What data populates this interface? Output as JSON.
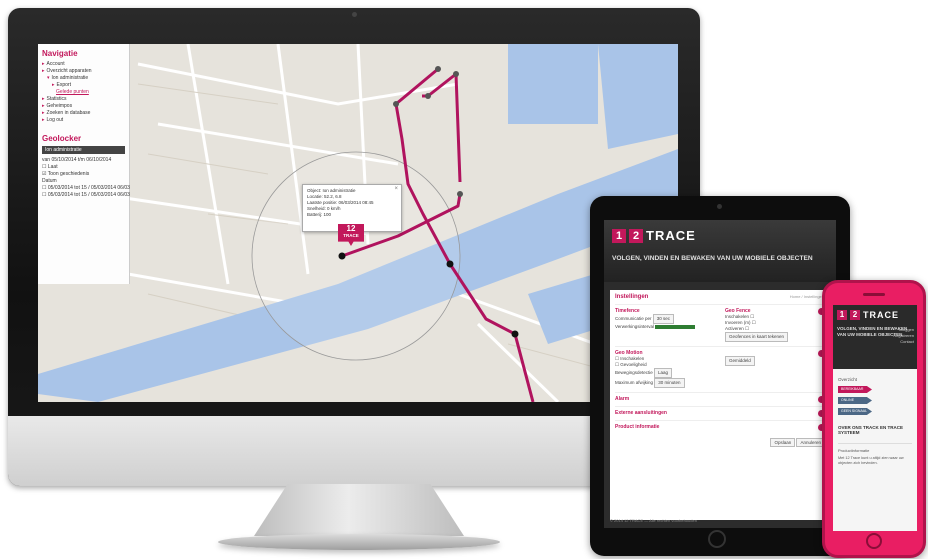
{
  "colors": {
    "accent": "#c2185b",
    "route": "#b0135e",
    "water": "#a9c4e8",
    "land": "#e6e3dc"
  },
  "map": {
    "nav_title": "Navigatie",
    "nav_items": [
      {
        "label": "Account",
        "level": 0
      },
      {
        "label": "Overzicht apparaten",
        "level": 0
      },
      {
        "label": "Ion administratie",
        "level": 1
      },
      {
        "label": "Export",
        "level": 2
      },
      {
        "label": "Gelede punten",
        "level": 3
      },
      {
        "label": "Statistics",
        "level": 0
      },
      {
        "label": "Geheimpos",
        "level": 0
      },
      {
        "label": "Zoeken in database",
        "level": 0
      },
      {
        "label": "Log out",
        "level": 0
      }
    ],
    "geo_title": "Geolocker",
    "geo_select": "Ion administratie",
    "geo_dates": "van 05/10/2014 t/m 06/10/2014",
    "geo_filters": [
      "Laat",
      "Toon geschiedenis",
      "Datum",
      "05/03/2014 tot 15 / 05/03/2014 06/03",
      "05/03/2014 tot 15 / 05/03/2014 06/03"
    ],
    "popup": {
      "lines": [
        "Object: Ion administratie",
        "Locatie: 52.2, 6.8",
        "Laatste positie: 06/03/2014 08:45",
        "Snelheid: 0 km/h",
        "Batterij: 100"
      ],
      "close": "×"
    },
    "marker_number": "12",
    "marker_word": "TRACE"
  },
  "tablet": {
    "logo_n1": "1",
    "logo_n2": "2",
    "logo_text": "TRACE",
    "tagline": "VOLGEN, VINDEN EN BEWAKEN VAN UW MOBIELE OBJECTEN",
    "page_title": "Instellingen",
    "crumb": "Home / Instellingen",
    "sections": {
      "timefence": {
        "title": "Timefence",
        "line1": "Communicatie per",
        "line1_val": "30 sec",
        "line2": "Verwerkingsinterval"
      },
      "geofence": {
        "title": "Geo Fence",
        "line1": "Inschakelen",
        "line2": "Invoeren (m)",
        "line3": "Activeren",
        "button": "Geofences in kaart tekenen"
      },
      "motion": {
        "title": "Geo Motion",
        "line1": "Inschakelen",
        "line2": "Gevoeligheid",
        "line3": "Bewegingsdetectie",
        "line4": "Maximum afwijking",
        "sel1": "Gemiddeld",
        "sel2": "Laag",
        "sel3": "30 minuten"
      },
      "alarm": {
        "title": "Alarm"
      },
      "external": {
        "title": "Externe aansluitingen"
      },
      "product": {
        "title": "Product informatie"
      }
    },
    "save_button": "Opslaan",
    "cancel_button": "Annuleren",
    "footer": "© 2014 12 TRACE — Alle rechten voorbehouden"
  },
  "phone": {
    "logo_n1": "1",
    "logo_n2": "2",
    "logo_text": "TRACE",
    "tagline": "VOLGEN, VINDEN EN BEWAKEN VAN UW MOBIELE OBJECTEN",
    "menu": [
      "Inloggen",
      "Registreren",
      "Contact"
    ],
    "section_title": "Overzicht",
    "badges": [
      "BEREIKBAAR",
      "ONLINE",
      "GEEN SIGNAAL"
    ],
    "sub_title": "OVER ONS TRACK EN TRACE SYSTEEM",
    "info_title": "Productinformatie",
    "info_text": "Met 12 Trace kunt u altijd zien waar uw objecten zich bevinden."
  }
}
